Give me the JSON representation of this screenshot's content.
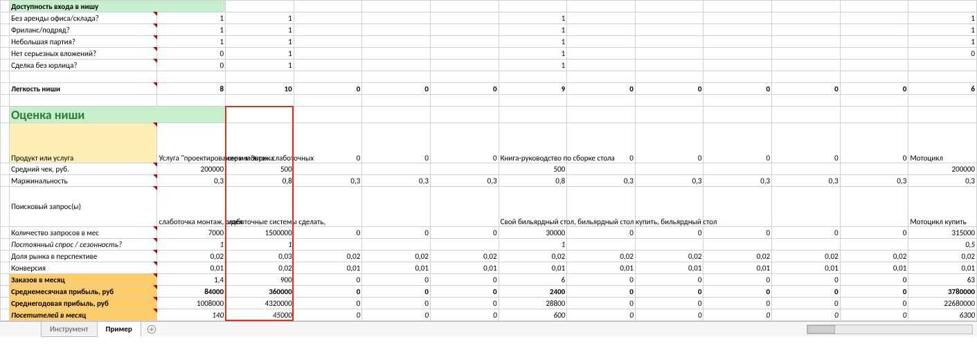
{
  "section1": {
    "title": "Доступность входа в нишу"
  },
  "entry_rows": [
    {
      "label": "Без аренды офиса/склада?",
      "vals": [
        "1",
        "1",
        "",
        "",
        "",
        "1",
        "",
        "",
        "",
        "",
        "",
        "1"
      ]
    },
    {
      "label": "Фриланс/подряд?",
      "vals": [
        "1",
        "1",
        "",
        "",
        "",
        "1",
        "",
        "",
        "",
        "",
        "",
        "1"
      ]
    },
    {
      "label": "Небольшая партия?",
      "vals": [
        "1",
        "1",
        "",
        "",
        "",
        "1",
        "",
        "",
        "",
        "",
        "",
        "1"
      ]
    },
    {
      "label": "Нет серьезных вложений?",
      "vals": [
        "0",
        "1",
        "",
        "",
        "",
        "1",
        "",
        "",
        "",
        "",
        "",
        "0"
      ]
    },
    {
      "label": "Сделка без юрлица?",
      "vals": [
        "0",
        "1",
        "",
        "",
        "",
        "1",
        "",
        "",
        "",
        "",
        "",
        ""
      ]
    }
  ],
  "ease": {
    "label": "Легкость ниши",
    "vals": [
      "8",
      "10",
      "0",
      "0",
      "0",
      "9",
      "0",
      "0",
      "0",
      "0",
      "0",
      "6"
    ]
  },
  "section2": {
    "title": "Оценка ниши"
  },
  "product_row": {
    "label": "Продукт или услуга",
    "vals": [
      "Услуга \"проектирование и монтаж слаботочных",
      "сервис Эврика",
      "0",
      "0",
      "0",
      "Книга-руководство по сборке стола",
      "0",
      "0",
      "0",
      "0",
      "0",
      "Мотоцикл"
    ]
  },
  "rows_numeric": [
    {
      "label": "Средний чек, руб.",
      "vals": [
        "200000",
        "500",
        "",
        "",
        "",
        "500",
        "",
        "",
        "",
        "",
        "",
        "200000"
      ]
    },
    {
      "label": "Маржинальность",
      "vals": [
        "0,3",
        "0,8",
        "0,3",
        "0,3",
        "0,3",
        "0,8",
        "0,3",
        "0,3",
        "0,3",
        "0,3",
        "0,3",
        "0,3"
      ]
    }
  ],
  "search_row": {
    "label": "Поисковый запрос(ы)",
    "vals": [
      "слаботочка монтаж, слаботочные системы сделать,",
      "идея",
      "",
      "",
      "",
      "Свой бильярдный стол, бильярдный стол купить, бильярдный стол",
      "",
      "",
      "",
      "",
      "",
      "Мотоцикл купить"
    ]
  },
  "rows_after": [
    {
      "label": "Количество запросов в мес",
      "vals": [
        "7000",
        "1500000",
        "0",
        "0",
        "0",
        "30000",
        "0",
        "0",
        "0",
        "0",
        "0",
        "315000"
      ],
      "italic": false,
      "bold": false
    },
    {
      "label": "Постоянный спрос / сезонность?",
      "vals": [
        "1",
        "1",
        "",
        "",
        "",
        "1",
        "",
        "",
        "",
        "",
        "",
        "0,5"
      ],
      "italic": true,
      "bold": false
    },
    {
      "label": "Доля рынка в перспективе",
      "vals": [
        "0,02",
        "0,03",
        "0,02",
        "0,02",
        "0,02",
        "0,02",
        "0,02",
        "0,02",
        "0,02",
        "0,02",
        "0,02",
        "0,02"
      ],
      "italic": false,
      "bold": false
    },
    {
      "label": "Конверсия",
      "vals": [
        "0,01",
        "0,02",
        "0,01",
        "0,01",
        "0,01",
        "0,01",
        "0,01",
        "0,01",
        "0,01",
        "0,01",
        "0,01",
        "0,01"
      ],
      "italic": false,
      "bold": false
    }
  ],
  "orange_rows": [
    {
      "label": "Заказов в месяц",
      "vals": [
        "1,4",
        "900",
        "0",
        "0",
        "0",
        "6",
        "0",
        "0",
        "0",
        "0",
        "0",
        "63"
      ],
      "bold": false
    },
    {
      "label": "Среднемесячная прибыль, руб",
      "vals": [
        "84000",
        "360000",
        "0",
        "0",
        "0",
        "2400",
        "0",
        "0",
        "0",
        "0",
        "0",
        "3780000"
      ],
      "bold": true
    },
    {
      "label": "Среднегодовая прибыль, руб",
      "vals": [
        "1008000",
        "4320000",
        "0",
        "0",
        "0",
        "28800",
        "0",
        "0",
        "0",
        "0",
        "0",
        "22680000"
      ],
      "bold": false
    }
  ],
  "last_row": {
    "label": "Посетителей в месяц",
    "vals": [
      "140",
      "45000",
      "0",
      "0",
      "0",
      "600",
      "0",
      "0",
      "0",
      "0",
      "0",
      "6300"
    ]
  },
  "tabs": {
    "items": [
      "Инструмент",
      "Пример"
    ],
    "active": 1
  },
  "col_widths": [
    "13",
    "212",
    "98",
    "98",
    "98",
    "98",
    "98",
    "98",
    "98",
    "98",
    "98",
    "98",
    "98",
    "98"
  ],
  "chart_data": {
    "type": "table",
    "title": "Оценка ниши (spreadsheet fragment)",
    "columns_count": 12,
    "entry_barrier": {
      "criteria": [
        "Без аренды офиса/склада?",
        "Фриланс/подряд?",
        "Небольшая партия?",
        "Нет серьезных вложений?",
        "Сделка без юрлица?"
      ],
      "matrix": [
        [
          "1",
          "1",
          "",
          "",
          "",
          "1",
          "",
          "",
          "",
          "",
          "",
          "1"
        ],
        [
          "1",
          "1",
          "",
          "",
          "",
          "1",
          "",
          "",
          "",
          "",
          "",
          "1"
        ],
        [
          "1",
          "1",
          "",
          "",
          "",
          "1",
          "",
          "",
          "",
          "",
          "",
          "1"
        ],
        [
          "0",
          "1",
          "",
          "",
          "",
          "1",
          "",
          "",
          "",
          "",
          "",
          "0"
        ],
        [
          "0",
          "1",
          "",
          "",
          "",
          "1",
          "",
          "",
          "",
          "",
          "",
          ""
        ]
      ],
      "ease_score": [
        "8",
        "10",
        "0",
        "0",
        "0",
        "9",
        "0",
        "0",
        "0",
        "0",
        "0",
        "6"
      ]
    },
    "products": [
      "Услуга \"проектирование и монтаж слаботочных",
      "сервис Эврика",
      "0",
      "0",
      "0",
      "Книга-руководство по сборке стола",
      "0",
      "0",
      "0",
      "0",
      "0",
      "Мотоцикл"
    ],
    "metrics": {
      "Средний чек, руб.": [
        "200000",
        "500",
        "",
        "",
        "",
        "500",
        "",
        "",
        "",
        "",
        "",
        "200000"
      ],
      "Маржинальность": [
        "0,3",
        "0,8",
        "0,3",
        "0,3",
        "0,3",
        "0,8",
        "0,3",
        "0,3",
        "0,3",
        "0,3",
        "0,3",
        "0,3"
      ],
      "Поисковый запрос(ы)": [
        "слаботочка монтаж, слаботочные системы сделать,",
        "идея",
        "",
        "",
        "",
        "Свой бильярдный стол, бильярдный стол купить, бильярдный стол",
        "",
        "",
        "",
        "",
        "",
        "Мотоцикл купить"
      ],
      "Количество запросов в мес": [
        "7000",
        "1500000",
        "0",
        "0",
        "0",
        "30000",
        "0",
        "0",
        "0",
        "0",
        "0",
        "315000"
      ],
      "Постоянный спрос / сезонность?": [
        "1",
        "1",
        "",
        "",
        "",
        "1",
        "",
        "",
        "",
        "",
        "",
        "0,5"
      ],
      "Доля рынка в перспективе": [
        "0,02",
        "0,03",
        "0,02",
        "0,02",
        "0,02",
        "0,02",
        "0,02",
        "0,02",
        "0,02",
        "0,02",
        "0,02",
        "0,02"
      ],
      "Конверсия": [
        "0,01",
        "0,02",
        "0,01",
        "0,01",
        "0,01",
        "0,01",
        "0,01",
        "0,01",
        "0,01",
        "0,01",
        "0,01",
        "0,01"
      ],
      "Заказов в месяц": [
        "1,4",
        "900",
        "0",
        "0",
        "0",
        "6",
        "0",
        "0",
        "0",
        "0",
        "0",
        "63"
      ],
      "Среднемесячная прибыль, руб": [
        "84000",
        "360000",
        "0",
        "0",
        "0",
        "2400",
        "0",
        "0",
        "0",
        "0",
        "0",
        "3780000"
      ],
      "Среднегодовая прибыль, руб": [
        "1008000",
        "4320000",
        "0",
        "0",
        "0",
        "28800",
        "0",
        "0",
        "0",
        "0",
        "0",
        "22680000"
      ],
      "Посетителей в месяц": [
        "140",
        "45000",
        "0",
        "0",
        "0",
        "600",
        "0",
        "0",
        "0",
        "0",
        "0",
        "6300"
      ]
    },
    "highlighted_column_index": 1
  }
}
